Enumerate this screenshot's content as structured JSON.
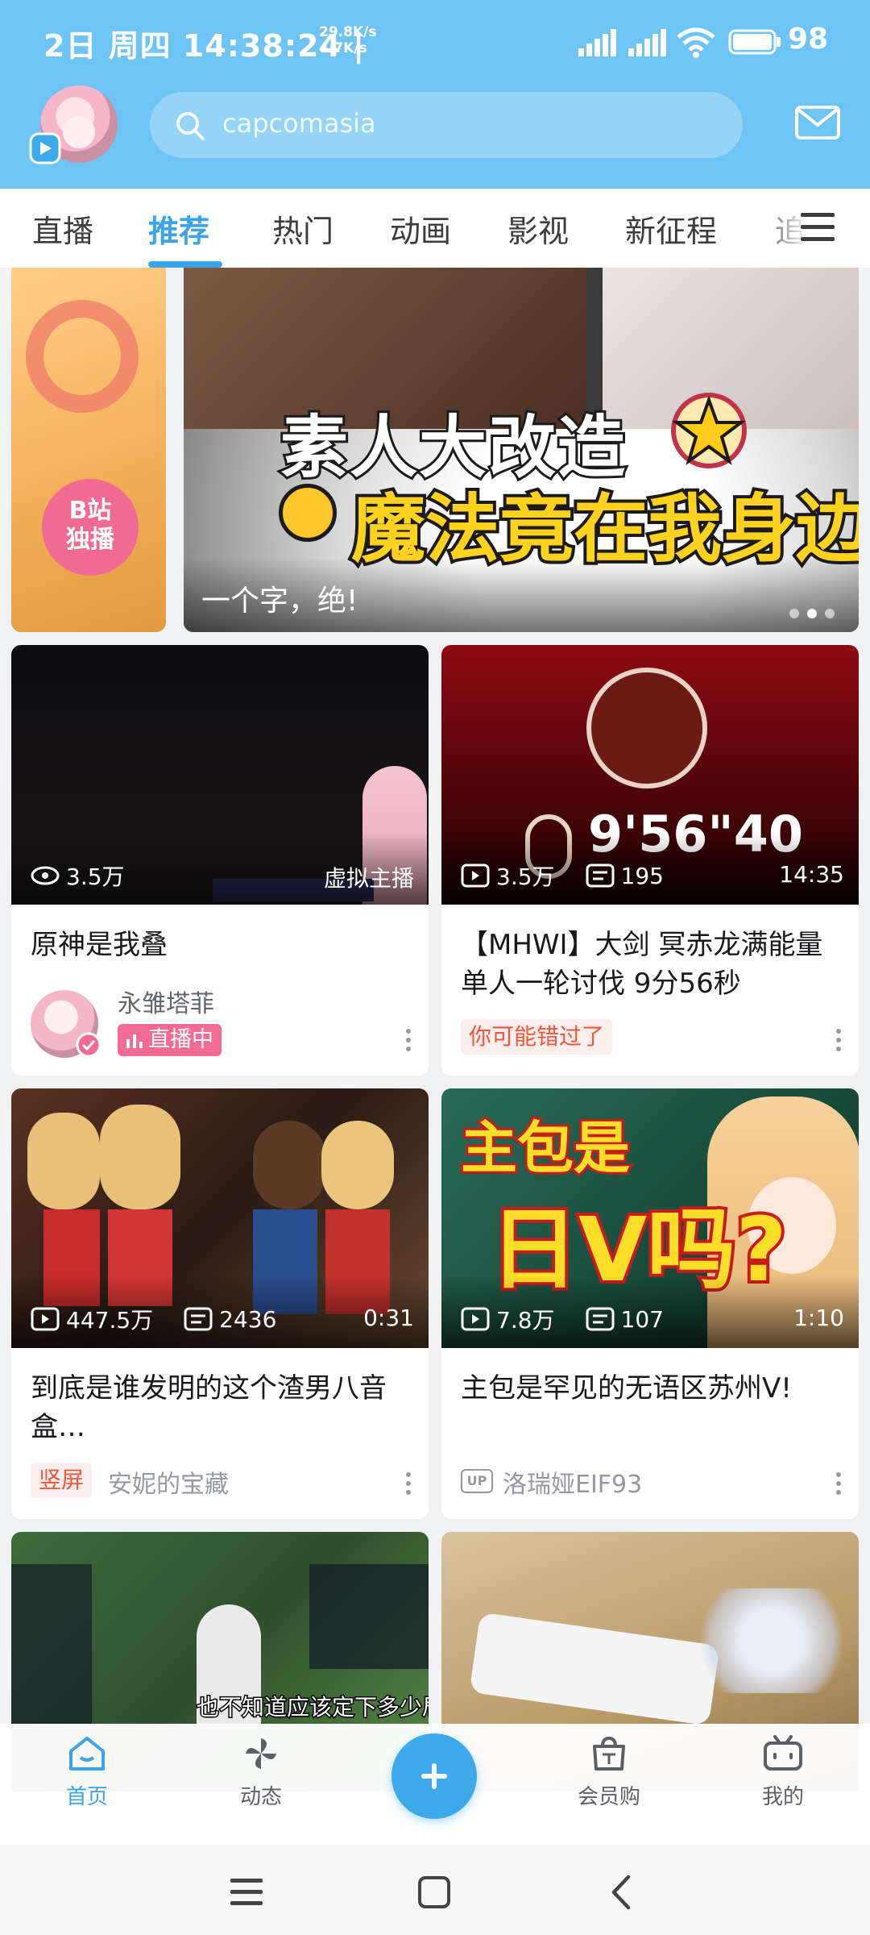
{
  "status_bar": {
    "time": "2日 周四 14:38:24 |",
    "speed_up": "29.8K/s",
    "speed_down": "4.7K/s",
    "battery": "98"
  },
  "header": {
    "search_placeholder": "capcomasia"
  },
  "tabs": [
    "直播",
    "推荐",
    "热门",
    "动画",
    "影视",
    "新征程",
    "追"
  ],
  "active_tab": "推荐",
  "banner": {
    "left_badge_line1": "B站",
    "left_badge_line2": "独播",
    "headline_1": "素人大改造",
    "headline_2": "魔法竟在我身边",
    "caption": "一个字，绝!"
  },
  "cards": [
    {
      "views": "3.5万",
      "overlay_right": "虚拟主播",
      "title": "原神是我叠",
      "author": "永雏塔菲",
      "live_tag": "直播中"
    },
    {
      "views": "3.5万",
      "danmaku": "195",
      "duration": "14:35",
      "thumb_text": "9'56\"40",
      "title": "【MHWI】大剑 冥赤龙满能量单人一轮讨伐 9分56秒",
      "tag": "你可能错过了"
    },
    {
      "views": "447.5万",
      "danmaku": "2436",
      "duration": "0:31",
      "title": "到底是谁发明的这个渣男八音盒…",
      "tag": "竖屏",
      "author": "安妮的宝藏"
    },
    {
      "views": "7.8万",
      "danmaku": "107",
      "duration": "1:10",
      "thumb_text_1": "主包是",
      "thumb_text_2": "日V吗?",
      "title": "主包是罕见的无语区苏州V!",
      "up_label": "UP",
      "author": "洛瑞娅EIF93"
    },
    {
      "thumb_text": "也不知道应该定下多少局"
    },
    {}
  ],
  "bottom_nav": {
    "home": "首页",
    "dynamic": "动态",
    "mall": "会员购",
    "mine": "我的"
  },
  "colors": {
    "header_bg": "#6ec4f4",
    "accent": "#3ea2e6",
    "live_pink": "#f36b92",
    "tag_red": "#f0573a"
  }
}
